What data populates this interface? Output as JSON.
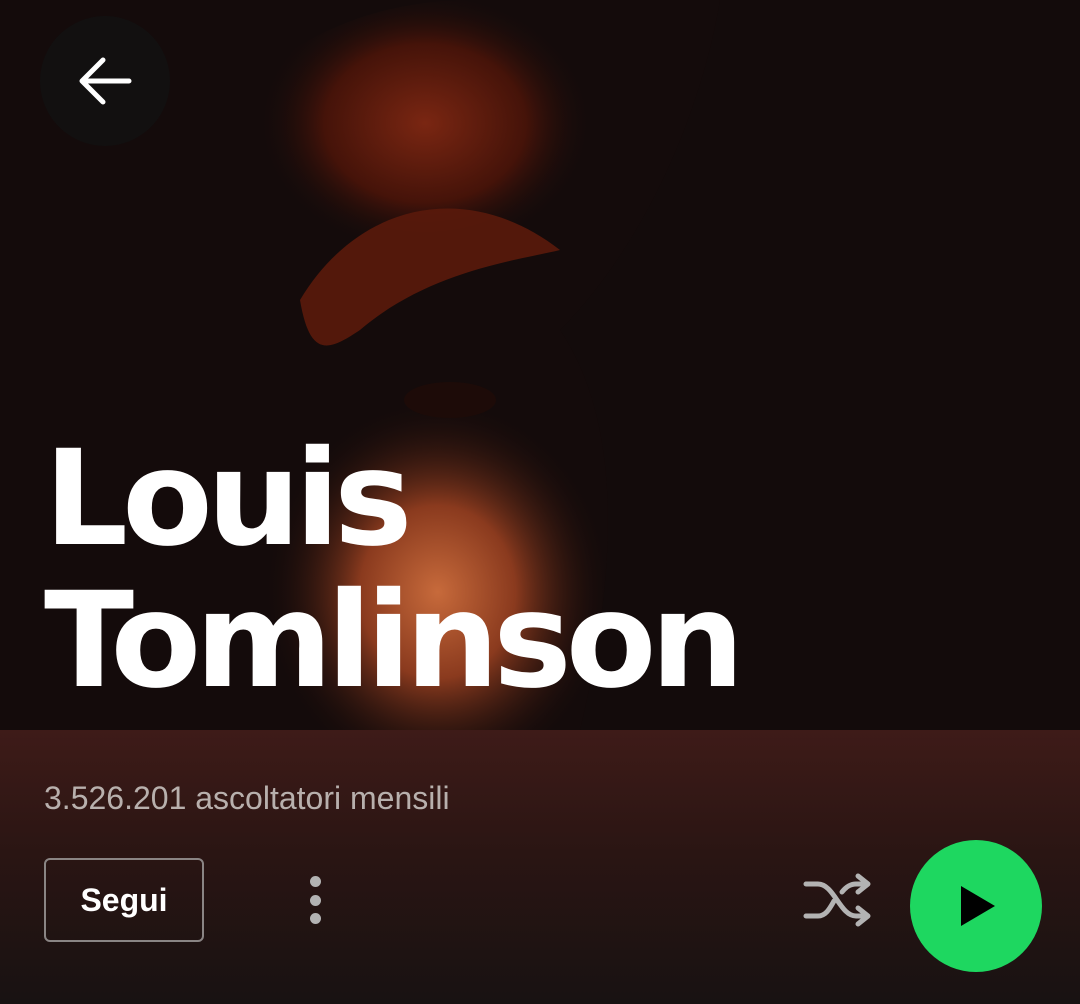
{
  "header": {
    "back_icon": "arrow-left-icon"
  },
  "hero": {
    "artist_name_line1": "Louis",
    "artist_name_line2": "Tomlinson"
  },
  "stats": {
    "monthly_listeners": "3.526.201 ascoltatori mensili"
  },
  "actions": {
    "follow_label": "Segui",
    "more_icon": "more-vertical-icon",
    "shuffle_icon": "shuffle-icon",
    "play_icon": "play-icon"
  },
  "colors": {
    "accent": "#1ed760",
    "panel": "#3e1b18",
    "background": "#121212"
  }
}
